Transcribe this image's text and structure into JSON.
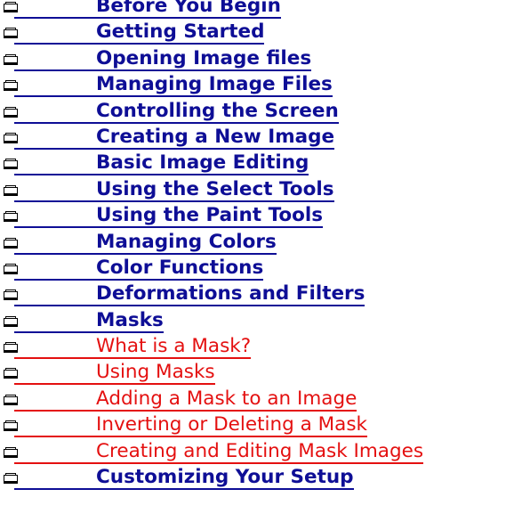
{
  "toc": {
    "items": [
      {
        "label": "Before You Begin",
        "kind": "book"
      },
      {
        "label": "Getting Started",
        "kind": "book"
      },
      {
        "label": "Opening Image files",
        "kind": "book"
      },
      {
        "label": "Managing Image Files",
        "kind": "book"
      },
      {
        "label": "Controlling the Screen",
        "kind": "book"
      },
      {
        "label": "Creating a New Image",
        "kind": "book"
      },
      {
        "label": "Basic Image Editing",
        "kind": "book"
      },
      {
        "label": "Using the Select Tools",
        "kind": "book"
      },
      {
        "label": "Using the Paint Tools",
        "kind": "book"
      },
      {
        "label": "Managing Colors",
        "kind": "book"
      },
      {
        "label": "Color Functions",
        "kind": "book"
      },
      {
        "label": "Deformations and Filters",
        "kind": "book"
      },
      {
        "label": "Masks",
        "kind": "book"
      },
      {
        "label": "What is a Mask?",
        "kind": "page"
      },
      {
        "label": "Using Masks",
        "kind": "page"
      },
      {
        "label": "Adding a Mask to an Image",
        "kind": "page"
      },
      {
        "label": "Inverting or Deleting a Mask",
        "kind": "page"
      },
      {
        "label": "Creating and Editing Mask Images",
        "kind": "page"
      },
      {
        "label": "Customizing Your Setup",
        "kind": "book"
      }
    ]
  },
  "colors": {
    "book_link": "#0e0e96",
    "page_link": "#e41010",
    "background": "#ffffff"
  },
  "icons": {
    "row_icon": "closed-book-icon"
  }
}
